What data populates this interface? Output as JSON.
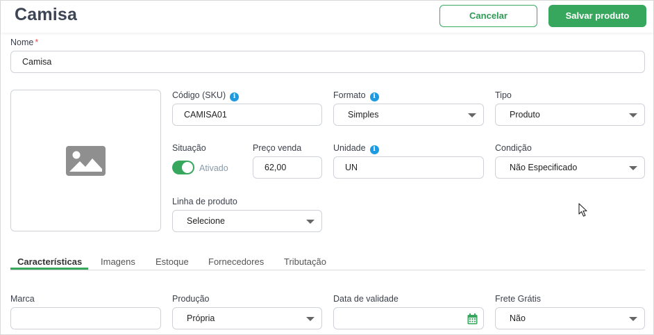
{
  "header": {
    "title": "Camisa",
    "cancel_label": "Cancelar",
    "save_label": "Salvar produto"
  },
  "form": {
    "nome": {
      "label": "Nome",
      "required_mark": "*",
      "value": "Camisa"
    },
    "sku": {
      "label": "Código (SKU)",
      "value": "CAMISA01"
    },
    "formato": {
      "label": "Formato",
      "value": "Simples"
    },
    "tipo": {
      "label": "Tipo",
      "value": "Produto"
    },
    "situacao": {
      "label": "Situação",
      "state_label": "Ativado",
      "enabled": true
    },
    "preco": {
      "label": "Preço venda",
      "value": "62,00"
    },
    "unidade": {
      "label": "Unidade",
      "value": "UN"
    },
    "condicao": {
      "label": "Condição",
      "value": "Não Especificado"
    },
    "linha": {
      "label": "Linha de produto",
      "value": "Selecione"
    }
  },
  "tabs": [
    {
      "label": "Características",
      "active": true
    },
    {
      "label": "Imagens",
      "active": false
    },
    {
      "label": "Estoque",
      "active": false
    },
    {
      "label": "Fornecedores",
      "active": false
    },
    {
      "label": "Tributação",
      "active": false
    }
  ],
  "caracteristicas": {
    "marca": {
      "label": "Marca",
      "value": ""
    },
    "producao": {
      "label": "Produção",
      "value": "Própria"
    },
    "validade": {
      "label": "Data de validade",
      "value": ""
    },
    "frete": {
      "label": "Frete Grátis",
      "value": "Não"
    }
  },
  "colors": {
    "accent": "#36a75d",
    "info": "#1e9be0",
    "title": "#3d4454"
  },
  "icons": [
    "info-icon",
    "image-placeholder-icon",
    "calendar-icon",
    "chevron-down-icon",
    "mouse-cursor-icon"
  ]
}
